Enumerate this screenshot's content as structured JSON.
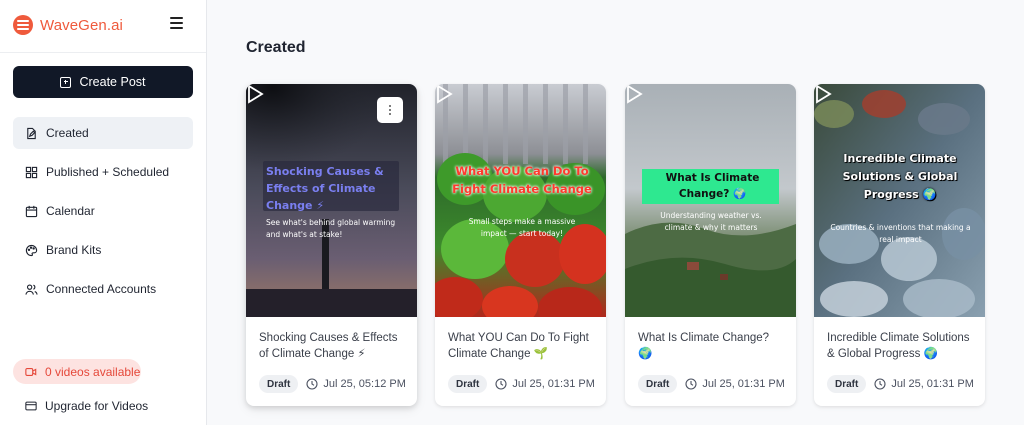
{
  "app": {
    "brand_name": "WaveGen.ai",
    "brand_color": "#ef5a3c"
  },
  "sidebar": {
    "create_label": "Create Post",
    "items": [
      {
        "label": "Created",
        "icon": "file-edit-icon",
        "active": true
      },
      {
        "label": "Published + Scheduled",
        "icon": "grid-icon"
      },
      {
        "label": "Calendar",
        "icon": "calendar-icon"
      },
      {
        "label": "Brand Kits",
        "icon": "palette-icon"
      },
      {
        "label": "Connected Accounts",
        "icon": "user-group-icon"
      }
    ],
    "videos_available": "0 videos available",
    "upgrade_label": "Upgrade for Videos"
  },
  "main": {
    "title": "Created",
    "cards": [
      {
        "title": "Shocking Causes & Effects of Climate Change ⚡",
        "status": "Draft",
        "date": "Jul 25, 05:12 PM",
        "overlay_title": "Shocking Causes & Effects of Climate Change ⚡",
        "overlay_sub": "See what's behind global warming and what's at stake!"
      },
      {
        "title": "What YOU Can Do To Fight Climate Change 🌱",
        "status": "Draft",
        "date": "Jul 25, 01:31 PM",
        "overlay_title": "What YOU Can Do To Fight Climate Change",
        "overlay_sub": "Small steps make a massive impact — start today!"
      },
      {
        "title": "What Is Climate Change? 🌍",
        "status": "Draft",
        "date": "Jul 25, 01:31 PM",
        "overlay_title": "What Is Climate Change? 🌍",
        "overlay_sub": "Understanding weather vs. climate & why it matters"
      },
      {
        "title": "Incredible Climate Solutions & Global Progress 🌍",
        "status": "Draft",
        "date": "Jul 25, 01:31 PM",
        "overlay_title": "Incredible Climate Solutions & Global Progress 🌍",
        "overlay_sub": "Countries & inventions that making a real impact"
      }
    ]
  }
}
